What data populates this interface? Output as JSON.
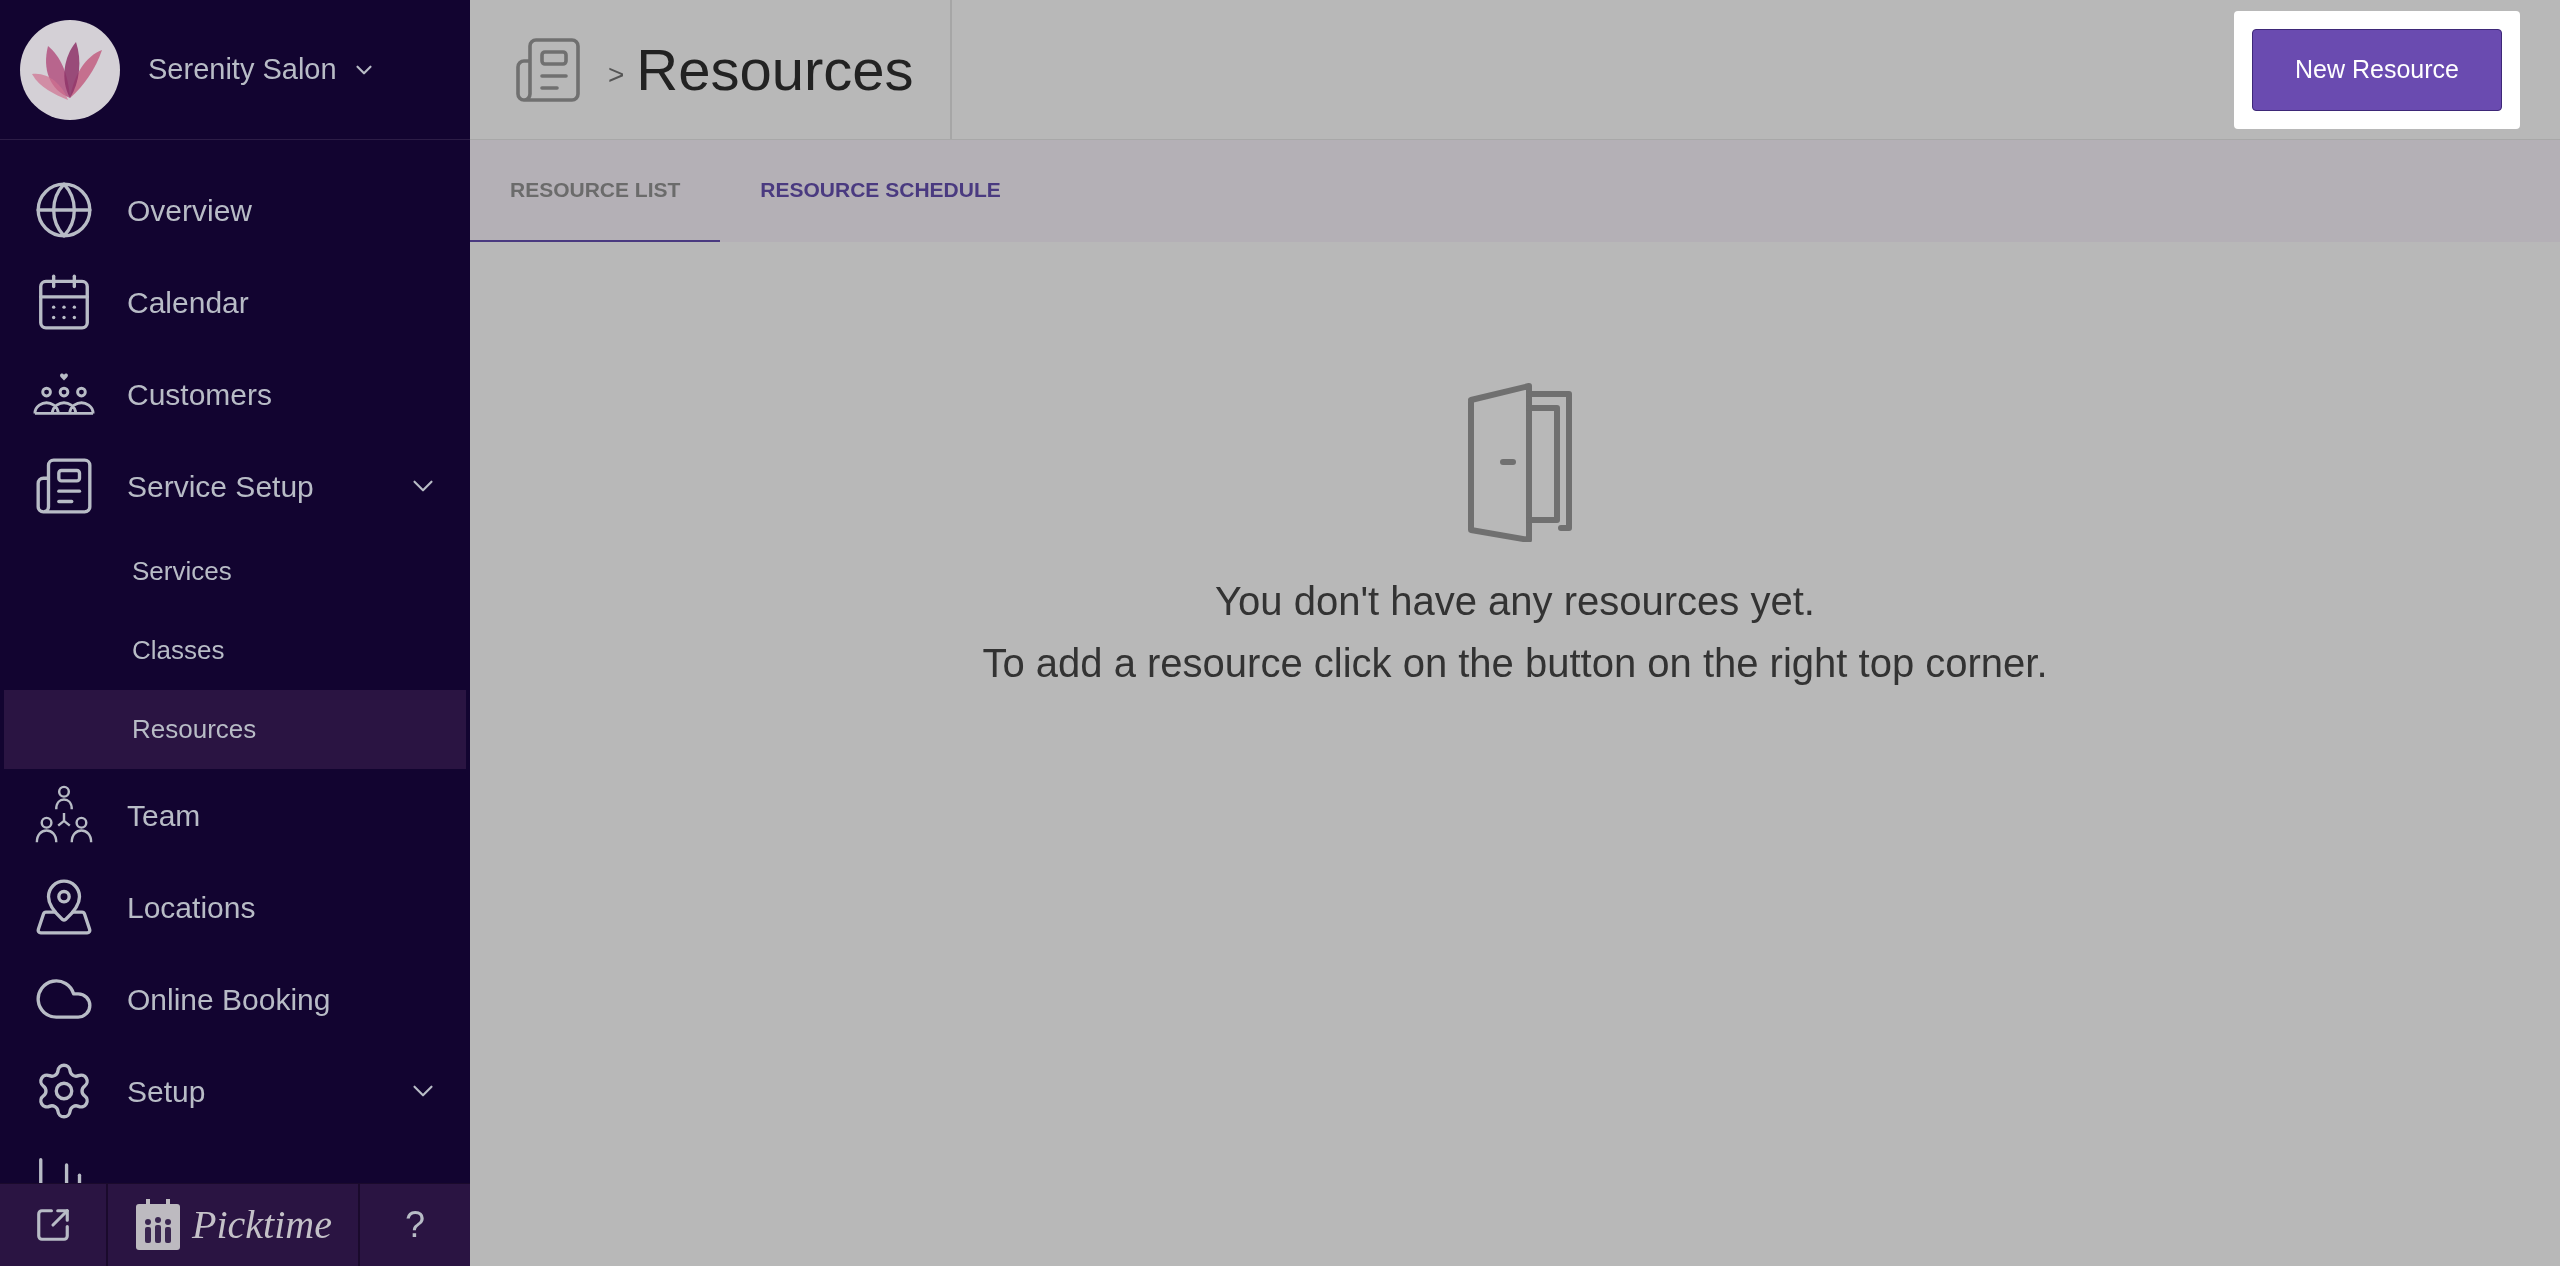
{
  "sidebar": {
    "business": {
      "name": "Serenity Salon"
    },
    "nav": [
      {
        "label": "Overview",
        "kind": "link",
        "selected": false
      },
      {
        "label": "Calendar",
        "kind": "link",
        "selected": false
      },
      {
        "label": "Customers",
        "kind": "link",
        "selected": false
      },
      {
        "label": "Service Setup",
        "kind": "group",
        "selected": false,
        "children": [
          {
            "label": "Services",
            "selected": false
          },
          {
            "label": "Classes",
            "selected": false
          },
          {
            "label": "Resources",
            "selected": true
          }
        ]
      },
      {
        "label": "Team",
        "kind": "link",
        "selected": false
      },
      {
        "label": "Locations",
        "kind": "link",
        "selected": false
      },
      {
        "label": "Online Booking",
        "kind": "link",
        "selected": false
      },
      {
        "label": "Setup",
        "kind": "group",
        "selected": false
      },
      {
        "kind": "link",
        "selected": false
      }
    ],
    "footer": {
      "brand": "Picktime",
      "help": "?"
    }
  },
  "header": {
    "separator": ">",
    "title": "Resources",
    "action": "New Resource"
  },
  "tabs": [
    {
      "label": "RESOURCE LIST",
      "selected": true
    },
    {
      "label": "RESOURCE SCHEDULE",
      "selected": false
    }
  ],
  "empty_state": {
    "lines": [
      "You don't have any resources yet.",
      "To add a resource click on the button on the right top corner."
    ]
  }
}
